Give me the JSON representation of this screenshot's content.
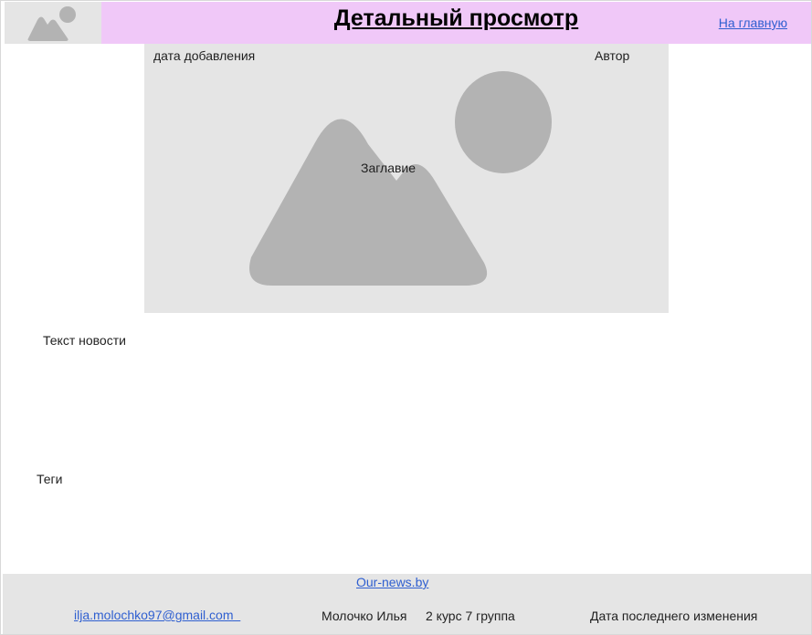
{
  "header": {
    "logo_icon": "image-placeholder-icon",
    "title": "Детальный просмотр",
    "home_link": "На главную",
    "background_color": "#f0c8f8"
  },
  "news": {
    "image_icon": "image-placeholder-icon",
    "date_added": "дата добавления",
    "author": "Автор",
    "title": "Заглавие",
    "text": "Текст новости",
    "tags": "Теги"
  },
  "footer": {
    "site_link": "Our-news.by",
    "email_link": "ilja.molochko97@gmail.com  ",
    "student_name": "Молочко Илья",
    "student_group": "2 курс 7 группа",
    "last_modified": "Дата последнего изменения"
  },
  "colors": {
    "placeholder_bg": "#e5e5e5",
    "placeholder_shape": "#b3b3b3",
    "link": "#2f5fd0"
  }
}
